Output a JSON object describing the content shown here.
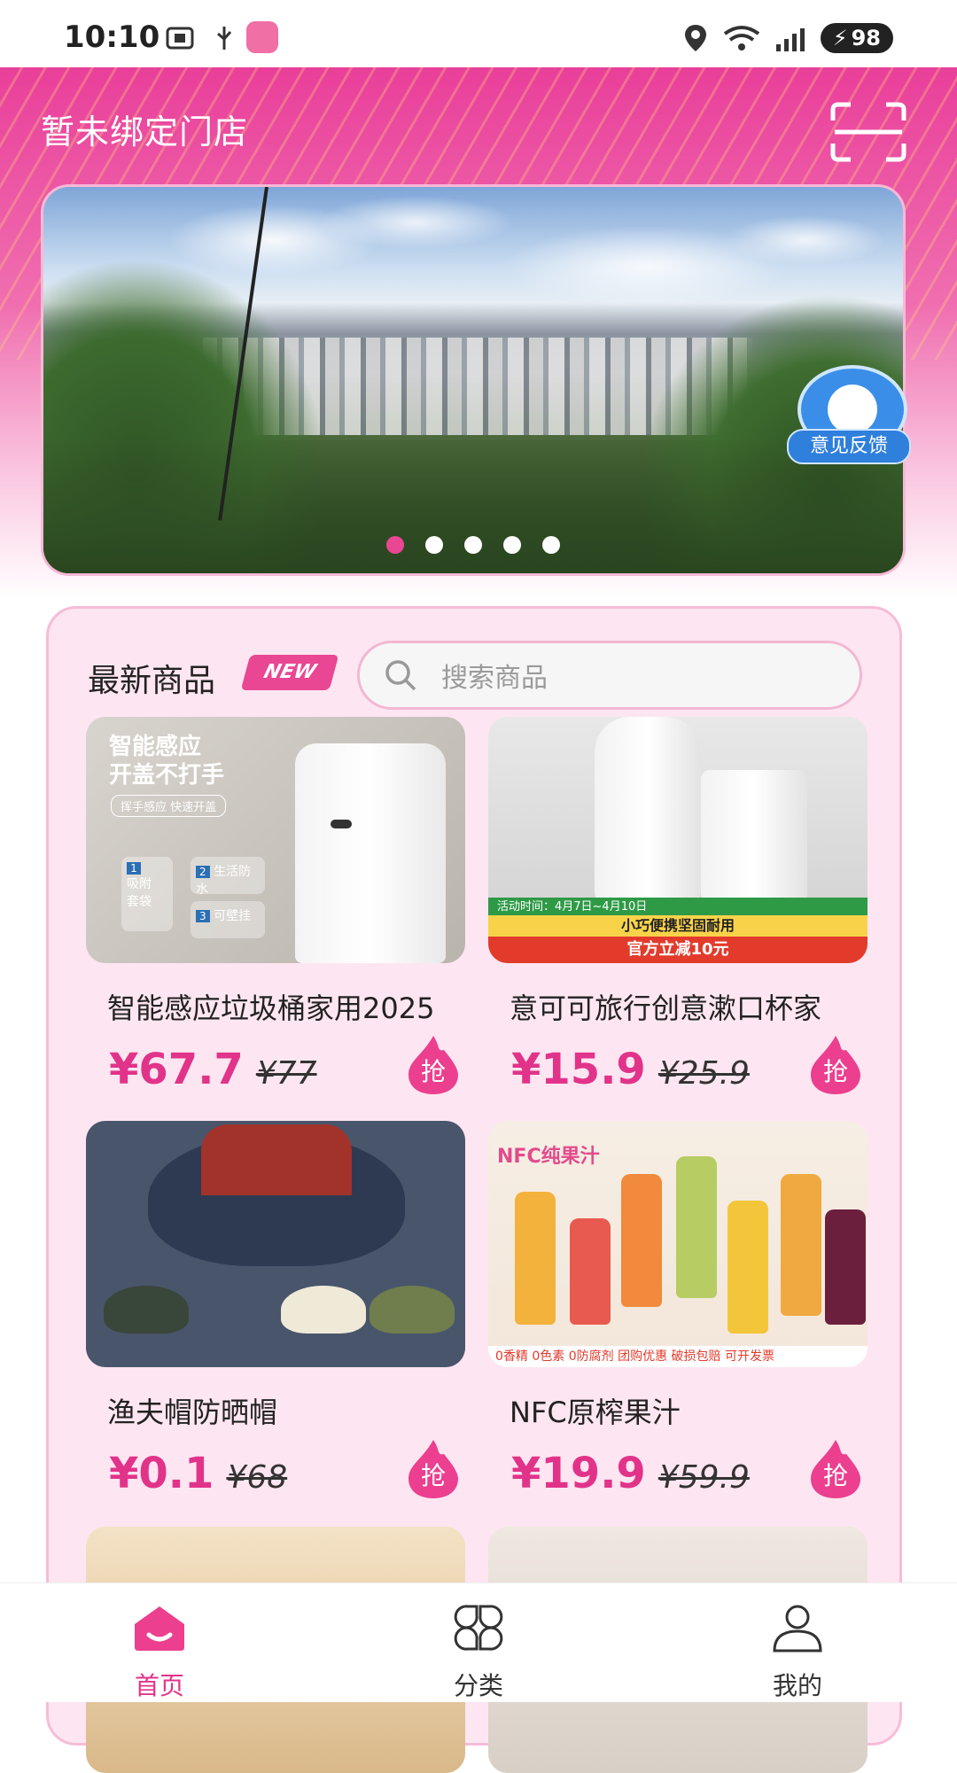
{
  "status_bar": {
    "time": "10:10",
    "battery": "98"
  },
  "header": {
    "store_title": "暂未绑定门店"
  },
  "banner": {
    "active_index": 0,
    "dot_count": 5
  },
  "feedback": {
    "label": "意见反馈"
  },
  "products_section": {
    "title": "最新商品",
    "badge": "NEW",
    "search_placeholder": "搜索商品"
  },
  "products": [
    {
      "name": "智能感应垃圾桶家用2025",
      "price": "¥67.7",
      "old_price": "¥77",
      "grab": "抢",
      "image_text": {
        "headline": "智能感应\n开盖不打手",
        "pill": "挥手感应 快速开盖",
        "chips": [
          "吸附\n套袋",
          "生活防水",
          "可壁挂"
        ],
        "chip_numbers": [
          "1",
          "2",
          "3"
        ]
      }
    },
    {
      "name": "意可可旅行创意漱口杯家",
      "price": "¥15.9",
      "old_price": "¥25.9",
      "grab": "抢",
      "image_text": {
        "band1": "活动时间：4月7日~4月10日",
        "band2": "小巧便携坚固耐用",
        "band3": "官方立减10元"
      }
    },
    {
      "name": "渔夫帽防晒帽",
      "price": "¥0.1",
      "old_price": "¥68",
      "grab": "抢",
      "image_text": {}
    },
    {
      "name": "NFC原榨果汁",
      "price": "¥19.9",
      "old_price": "¥59.9",
      "grab": "抢",
      "image_text": {
        "headline": "NFC纯果汁",
        "bottom": "0香精 0色素 0防腐剂  团购优惠 破损包赔 可开发票"
      }
    }
  ],
  "tabbar": {
    "items": [
      {
        "label": "首页",
        "icon": "home-icon",
        "active": true
      },
      {
        "label": "分类",
        "icon": "category-icon",
        "active": false
      },
      {
        "label": "我的",
        "icon": "profile-icon",
        "active": false
      }
    ]
  },
  "colors": {
    "accent": "#e2338a",
    "header_pink": "#e93f9a",
    "panel_bg": "#fde6f1"
  }
}
